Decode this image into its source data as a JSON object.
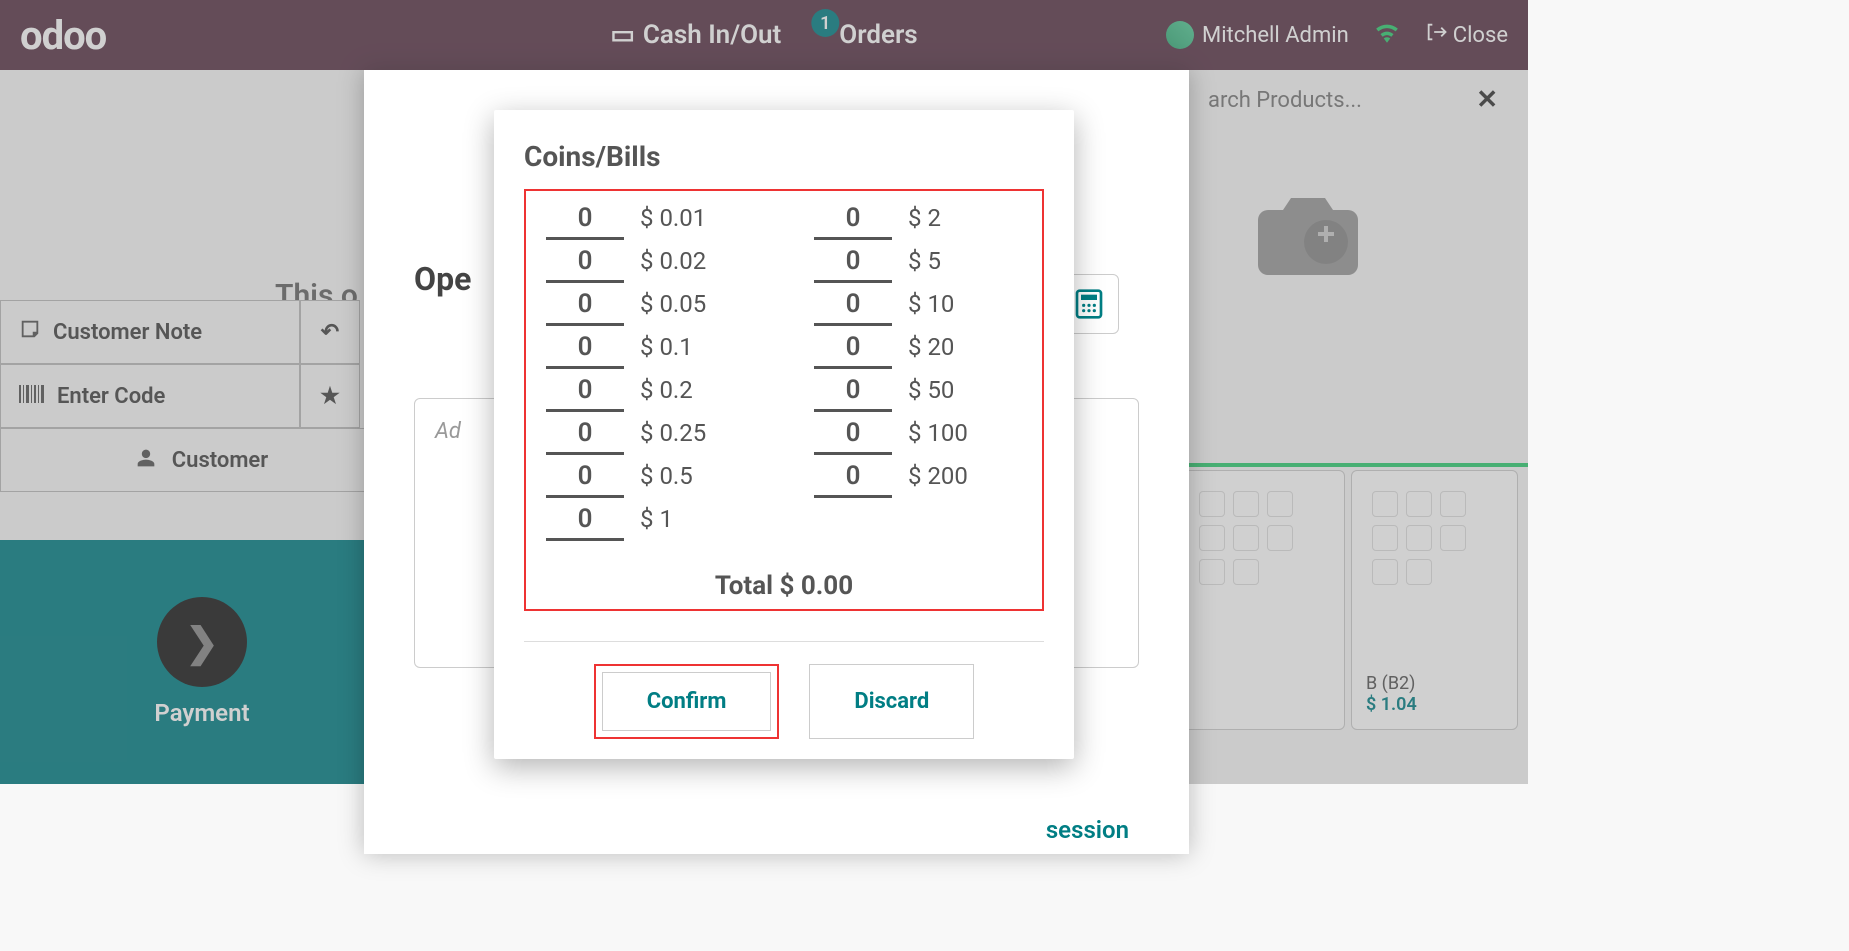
{
  "navbar": {
    "logo": "odoo",
    "cash_label": "Cash In/Out",
    "orders_label": "Orders",
    "orders_badge": "1",
    "user_name": "Mitchell Admin",
    "close_label": "Close"
  },
  "sidebar": {
    "customer_note": "Customer Note",
    "enter_code": "Enter Code",
    "customer": "Customer"
  },
  "payment": {
    "label": "Payment"
  },
  "background": {
    "this_order": "This o",
    "search_placeholder": "arch Products...",
    "product_b_name": "B (B2)",
    "product_b_price": "$ 1.04"
  },
  "modal1": {
    "heading_partial": "Ope",
    "note_placeholder": "Ad",
    "session_btn_partial": "session"
  },
  "modal2": {
    "title": "Coins/Bills",
    "left_denominations": [
      {
        "value": "0",
        "label": "$ 0.01"
      },
      {
        "value": "0",
        "label": "$ 0.02"
      },
      {
        "value": "0",
        "label": "$ 0.05"
      },
      {
        "value": "0",
        "label": "$ 0.1"
      },
      {
        "value": "0",
        "label": "$ 0.2"
      },
      {
        "value": "0",
        "label": "$ 0.25"
      },
      {
        "value": "0",
        "label": "$ 0.5"
      },
      {
        "value": "0",
        "label": "$ 1"
      }
    ],
    "right_denominations": [
      {
        "value": "0",
        "label": "$ 2"
      },
      {
        "value": "0",
        "label": "$ 5"
      },
      {
        "value": "0",
        "label": "$ 10"
      },
      {
        "value": "0",
        "label": "$ 20"
      },
      {
        "value": "0",
        "label": "$ 50"
      },
      {
        "value": "0",
        "label": "$ 100"
      },
      {
        "value": "0",
        "label": "$ 200"
      }
    ],
    "total_label": "Total $ 0.00",
    "confirm_label": "Confirm",
    "discard_label": "Discard"
  }
}
